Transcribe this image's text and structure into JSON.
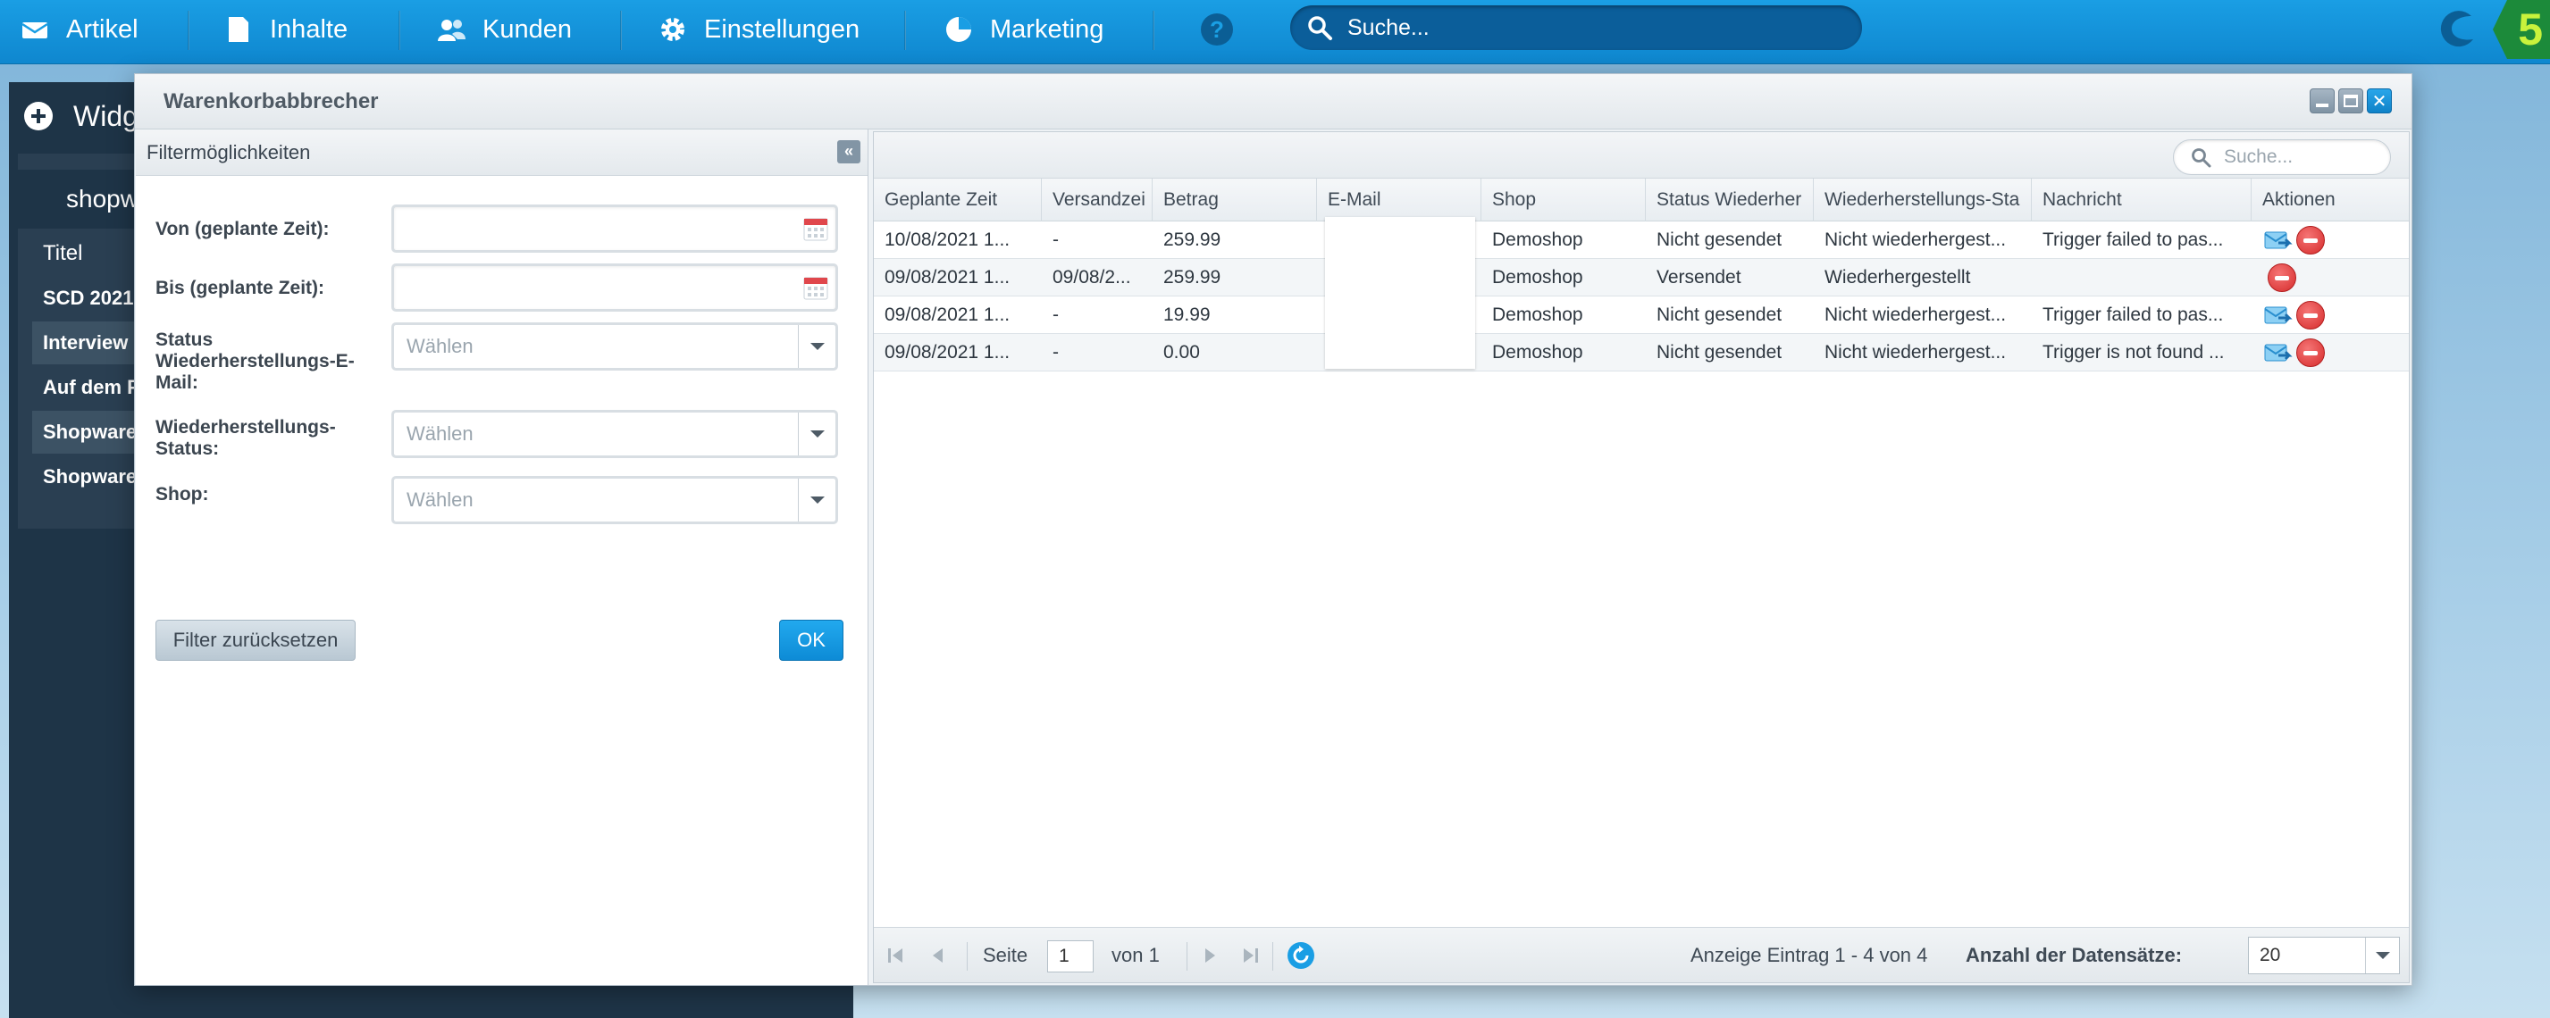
{
  "topnav": {
    "items": [
      {
        "label": "Artikel",
        "icon": "envelope-icon"
      },
      {
        "label": "Inhalte",
        "icon": "document-icon"
      },
      {
        "label": "Kunden",
        "icon": "users-icon"
      },
      {
        "label": "Einstellungen",
        "icon": "gear-icon"
      },
      {
        "label": "Marketing",
        "icon": "pie-chart-icon"
      }
    ],
    "help": "?",
    "search_placeholder": "Suche...",
    "logo_text": "5"
  },
  "dashboard": {
    "header": "Widg",
    "tab": "shopw",
    "rows": [
      "Titel",
      "SCD 2021",
      "Interview",
      "Auf dem F",
      "Shopware",
      "Shopware"
    ]
  },
  "window": {
    "title": "Warenkorbabbrecher"
  },
  "filter": {
    "title": "Filtermöglichkeiten",
    "collapse_icon": "«",
    "fields": {
      "from_label": "Von (geplante Zeit):",
      "to_label": "Bis (geplante Zeit):",
      "status_label": "Status Wiederherstellungs-E-Mail:",
      "restore_label": "Wiederherstellungs-Status:",
      "shop_label": "Shop:",
      "select_placeholder": "Wählen"
    },
    "reset_button": "Filter zurücksetzen",
    "ok_button": "OK"
  },
  "grid": {
    "search_placeholder": "Suche...",
    "columns": [
      "Geplante Zeit",
      "Versandzei",
      "Betrag",
      "E-Mail",
      "Shop",
      "Status Wiederher",
      "Wiederherstellungs-Sta",
      "Nachricht",
      "Aktionen"
    ],
    "rows": [
      [
        "10/08/2021 1...",
        "-",
        "259.99",
        "",
        "Demoshop",
        "Nicht gesendet",
        "Nicht wiederhergest...",
        "Trigger failed to pas..."
      ],
      [
        "09/08/2021 1...",
        "09/08/2...",
        "259.99",
        "",
        "Demoshop",
        "Versendet",
        "Wiederhergestellt",
        ""
      ],
      [
        "09/08/2021 1...",
        "-",
        "19.99",
        "",
        "Demoshop",
        "Nicht gesendet",
        "Nicht wiederhergest...",
        "Trigger failed to pas..."
      ],
      [
        "09/08/2021 1...",
        "-",
        "0.00",
        "",
        "Demoshop",
        "Nicht gesendet",
        "Nicht wiederhergest...",
        "Trigger is not found ..."
      ]
    ],
    "row_actions": [
      {
        "send": true,
        "delete": true
      },
      {
        "send": false,
        "delete": true
      },
      {
        "send": true,
        "delete": true
      },
      {
        "send": true,
        "delete": true
      }
    ]
  },
  "pager": {
    "page_label": "Seite",
    "page_value": "1",
    "of_label": "von 1",
    "display_info": "Anzeige Eintrag 1 - 4 von 4",
    "records_label": "Anzahl der Datensätze:",
    "records_value": "20"
  },
  "colors": {
    "topbar": "#1a9ee4",
    "accent": "#0f87cf",
    "delete": "#d62c2c"
  }
}
